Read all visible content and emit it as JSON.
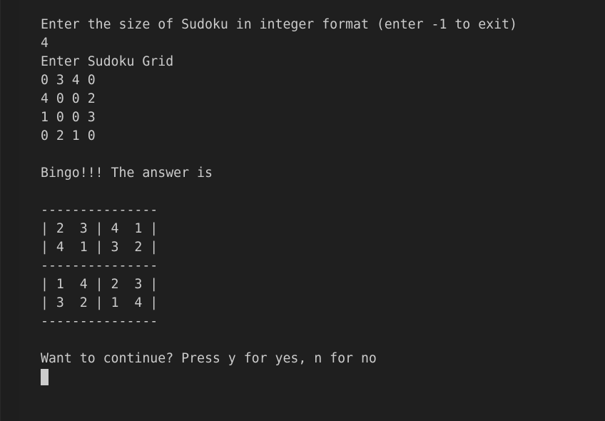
{
  "terminal": {
    "lines": [
      "Enter the size of Sudoku in integer format (enter -1 to exit)",
      "4",
      "Enter Sudoku Grid",
      "0 3 4 0",
      "4 0 0 2",
      "1 0 0 3",
      "0 2 1 0",
      "",
      "Bingo!!! The answer is",
      "",
      "---------------",
      "| 2  3 | 4  1 |",
      "| 4  1 | 3  2 |",
      "---------------",
      "| 1  4 | 2  3 |",
      "| 3  2 | 1  4 |",
      "---------------",
      "",
      "Want to continue? Press y for yes, n for no"
    ]
  },
  "colors": {
    "background": "#1f1f1f",
    "text": "#cccccc",
    "cursor": "#cccccc"
  }
}
